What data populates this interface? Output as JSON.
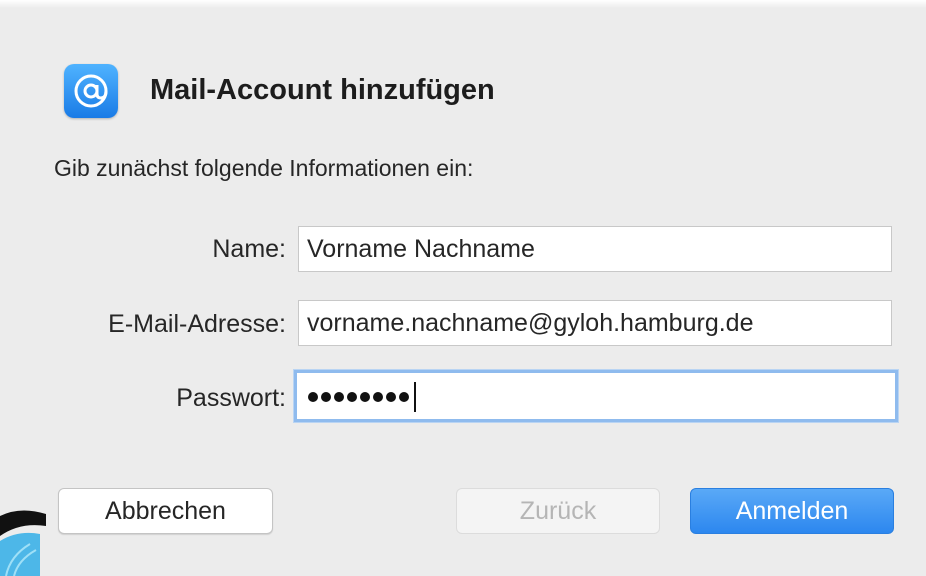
{
  "dialog": {
    "title": "Mail-Account hinzufügen",
    "subtitle": "Gib zunächst folgende Informationen ein:",
    "app_icon": "at-sign-icon"
  },
  "form": {
    "name_label": "Name:",
    "name_value": "Vorname Nachname",
    "email_label": "E-Mail-Adresse:",
    "email_value": "vorname.nachname@gyloh.hamburg.de",
    "password_label": "Passwort:",
    "password_dot_count": 8
  },
  "buttons": {
    "cancel_label": "Abbrechen",
    "back_label": "Zurück",
    "login_label": "Anmelden"
  },
  "colors": {
    "accent": "#2c87ef",
    "focus_ring": "#8fbbee",
    "background": "#ececec"
  }
}
